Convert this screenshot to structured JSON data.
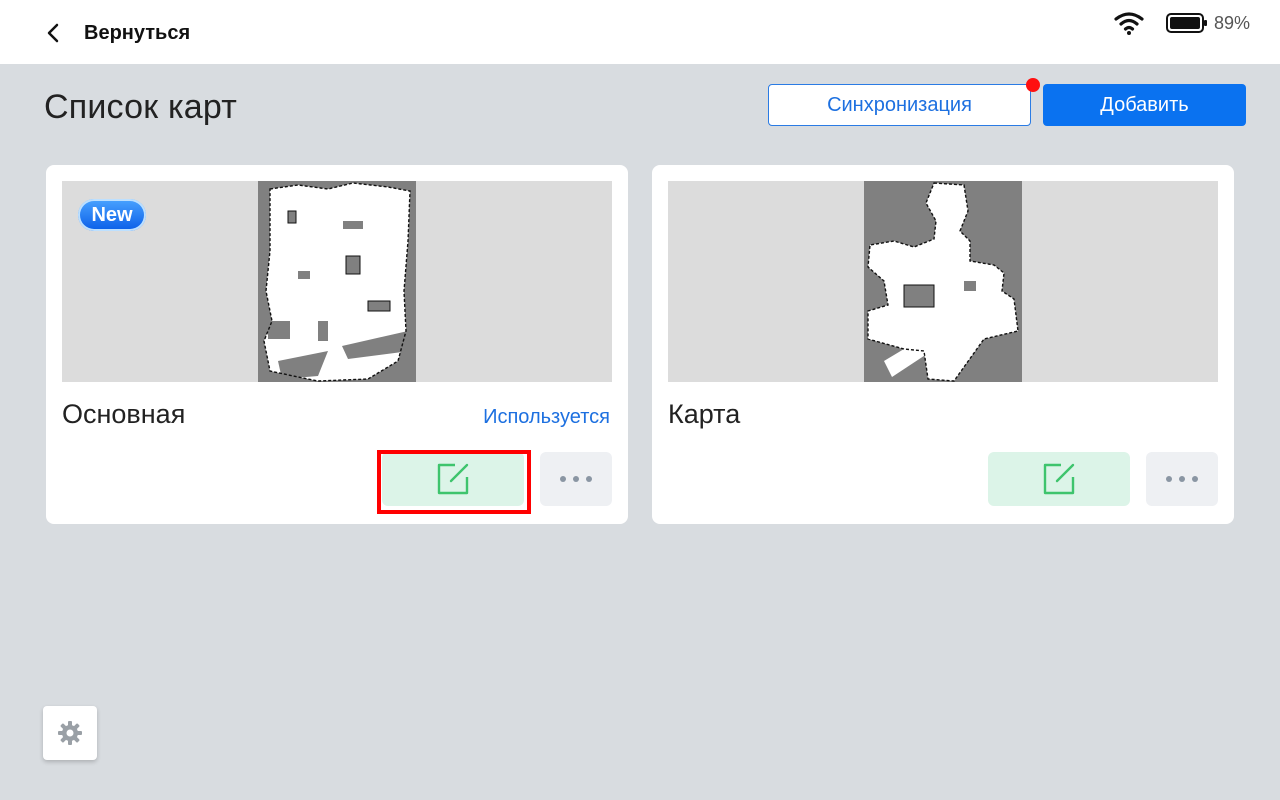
{
  "header": {
    "back_label": "Вернуться",
    "battery_percent": "89%",
    "icons": [
      "chevron-left-icon",
      "wifi-icon",
      "battery-icon"
    ]
  },
  "page": {
    "title": "Список карт",
    "sync_label": "Синхронизация",
    "add_label": "Добавить"
  },
  "maps": [
    {
      "name": "Основная",
      "status": "Используется",
      "badge": "New"
    },
    {
      "name": "Карта",
      "status": "",
      "badge": ""
    }
  ],
  "colors": {
    "accent": "#0a72f0",
    "sync_notification_dot": "#ff1010",
    "edit_bg": "#dcf4e8",
    "edit_icon": "#3ec46d",
    "highlight": "#ff0000"
  }
}
